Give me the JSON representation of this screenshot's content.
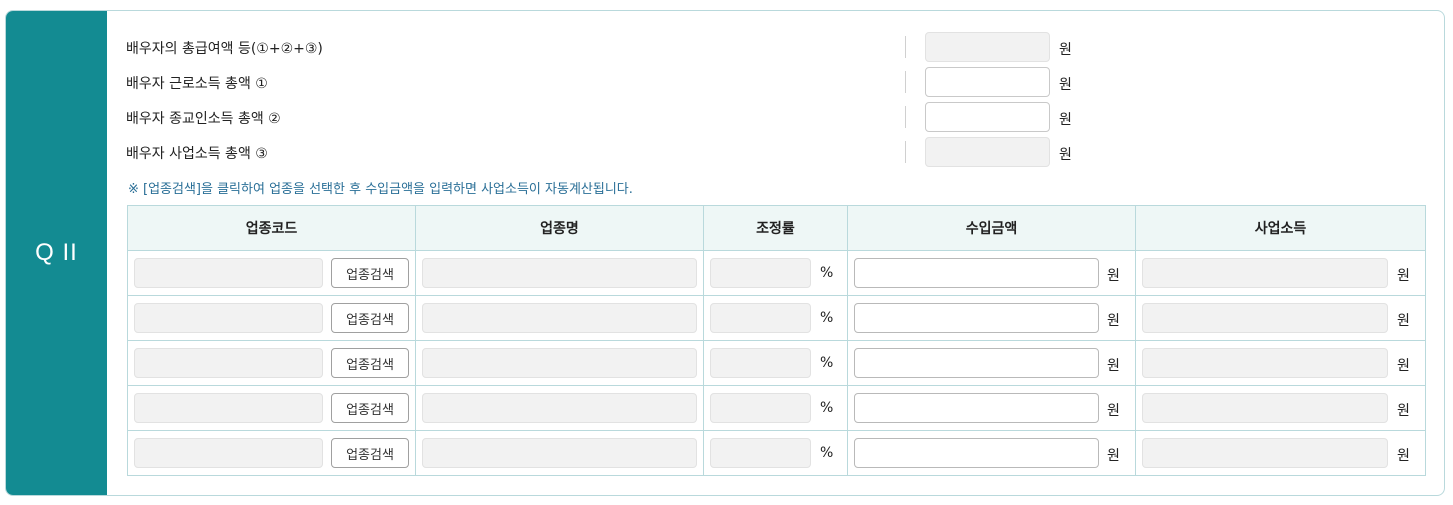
{
  "section": {
    "label": "Q II"
  },
  "summary": [
    {
      "label": "배우자의 총급여액 등(①+②+③)",
      "unit": "원",
      "readonly": true,
      "value": ""
    },
    {
      "label": "배우자 근로소득 총액 ①",
      "unit": "원",
      "readonly": false,
      "value": ""
    },
    {
      "label": "배우자 종교인소득 총액 ②",
      "unit": "원",
      "readonly": false,
      "value": ""
    },
    {
      "label": "배우자 사업소득 총액 ③",
      "unit": "원",
      "readonly": true,
      "value": ""
    }
  ],
  "notice": "※ [업종검색]을 클릭하여 업종을 선택한 후 수입금액을 입력하면 사업소득이 자동계산됩니다.",
  "table": {
    "headers": [
      "업종코드",
      "업종명",
      "조정률",
      "수입금액",
      "사업소득"
    ],
    "search_button_label": "업종검색",
    "percent_unit": "%",
    "won_unit": "원",
    "rows": [
      {
        "code": "",
        "name": "",
        "rate": "",
        "amount": "",
        "income": ""
      },
      {
        "code": "",
        "name": "",
        "rate": "",
        "amount": "",
        "income": ""
      },
      {
        "code": "",
        "name": "",
        "rate": "",
        "amount": "",
        "income": ""
      },
      {
        "code": "",
        "name": "",
        "rate": "",
        "amount": "",
        "income": ""
      },
      {
        "code": "",
        "name": "",
        "rate": "",
        "amount": "",
        "income": ""
      }
    ]
  }
}
